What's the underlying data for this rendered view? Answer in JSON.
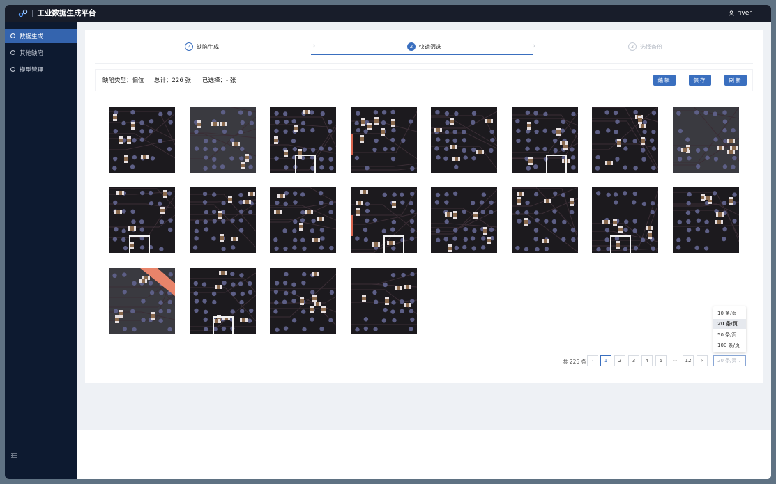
{
  "app": {
    "title": "工业数据生成平台",
    "separator": "|",
    "user": "river"
  },
  "sidebar": {
    "items": [
      {
        "label": "数据生成",
        "active": true
      },
      {
        "label": "其他缺陷",
        "active": false
      },
      {
        "label": "模型管理",
        "active": false
      }
    ]
  },
  "steps": [
    {
      "label": "缺陷生成",
      "number": "✓",
      "state": "done"
    },
    {
      "label": "快速筛选",
      "number": "2",
      "state": "current"
    },
    {
      "label": "选择备份",
      "number": "3",
      "state": "todo"
    }
  ],
  "info": {
    "defect_type": "缺陷类型：偏位",
    "total": "总计：226 张",
    "selected": "已选择：- 张"
  },
  "buttons": {
    "edit": "编辑",
    "save": "保存",
    "refresh": "刷新"
  },
  "gallery": {
    "count": 20
  },
  "pagination": {
    "total_text": "共 226 条",
    "prev": "‹",
    "next": "›",
    "pages": [
      "1",
      "2",
      "3",
      "4",
      "5"
    ],
    "ellipsis": "···",
    "last": "12",
    "current": "1",
    "page_size": "20 条/页",
    "page_size_options": [
      "10 条/页",
      "20 条/页",
      "50 条/页",
      "100 条/页"
    ],
    "selected_option": "20 条/页"
  },
  "colors": {
    "accent": "#3a6fbf",
    "topbar": "#181d2a",
    "sidebar": "#0d1a30",
    "pad": "#5d5f86",
    "board": "#1c1a1e"
  }
}
